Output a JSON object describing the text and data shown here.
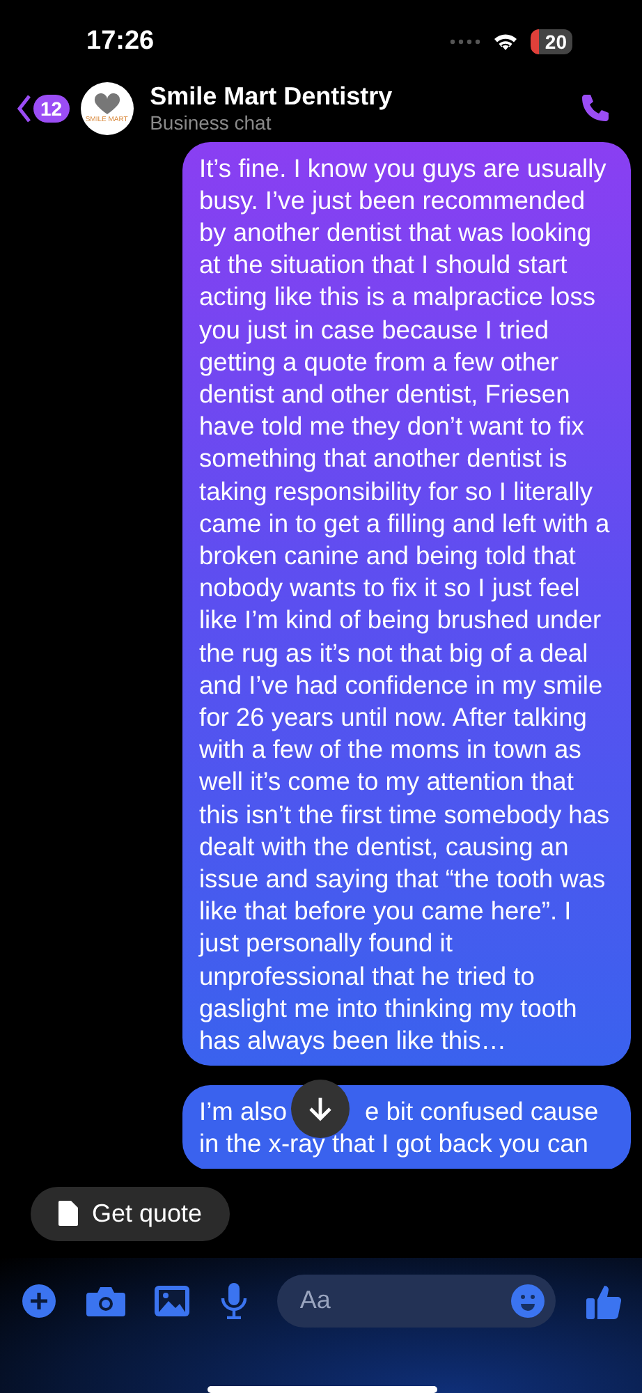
{
  "status_bar": {
    "time": "17:26",
    "battery": "20"
  },
  "header": {
    "back_count": "12",
    "avatar_text": "SMILE MART",
    "title": "Smile Mart Dentistry",
    "subtitle": "Business chat"
  },
  "messages": [
    {
      "kind": "sent",
      "parts": [
        "It’s fine. I know you guys are usually busy. I’ve just been recommended by another dentist that was looking at the situation that I should start acting like this is a malpractice loss you just in case because I tried getting a quote from a few other dentist and other dentist, Friesen have told me they don’t want to fix something that another dentist is taking responsibility for so I literally came in to get a filling and left with a broken canine and being told that nobody wants to fix it so I just feel like I’m kind of being brushed under the rug as it’s not that big of a deal and I’ve had confidence in my smile for 26 years until now. After talking with a few of the moms in town as well it’s come to my attention that this isn’t the first time somebody has dealt with the dentist, causing an issue and saying that “the tooth was like that before you came here”. I just personally found it unprofessional that he tried to gaslight me into thinking my tooth has always been like this…"
      ]
    },
    {
      "kind": "sent-covered",
      "parts": [
        "I’m also",
        "e bit confused cause in the x-ray that I got back you can"
      ]
    }
  ],
  "quick_reply": {
    "label": "Get quote"
  },
  "composer": {
    "placeholder": "Aa"
  }
}
